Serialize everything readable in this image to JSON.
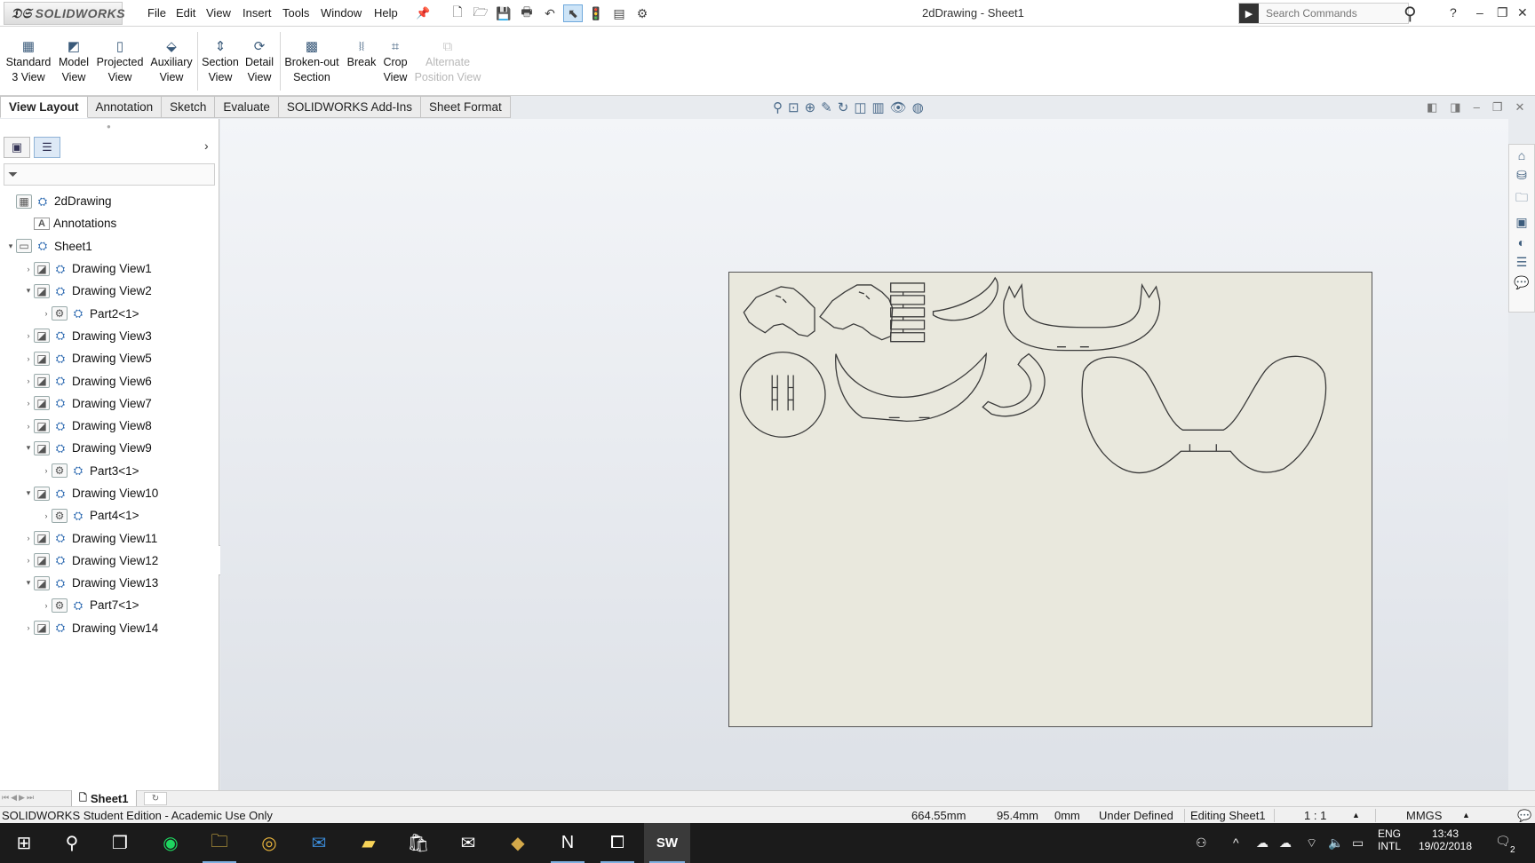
{
  "app": {
    "logo_text": "SOLIDWORKS",
    "document_title": "2dDrawing - Sheet1"
  },
  "menu": [
    "File",
    "Edit",
    "View",
    "Insert",
    "Tools",
    "Window",
    "Help"
  ],
  "search": {
    "placeholder": "Search Commands"
  },
  "commands": [
    {
      "line1": "Standard",
      "line2": "3 View",
      "icon": "standard-3-view-icon",
      "enabled": true
    },
    {
      "line1": "Model",
      "line2": "View",
      "icon": "model-view-icon",
      "enabled": true
    },
    {
      "line1": "Projected",
      "line2": "View",
      "icon": "projected-view-icon",
      "enabled": true
    },
    {
      "line1": "Auxiliary",
      "line2": "View",
      "icon": "auxiliary-view-icon",
      "enabled": true
    },
    {
      "line1": "Section",
      "line2": "View",
      "icon": "section-view-icon",
      "enabled": true
    },
    {
      "line1": "Detail",
      "line2": "View",
      "icon": "detail-view-icon",
      "enabled": true
    },
    {
      "line1": "Broken-out",
      "line2": "Section",
      "icon": "broken-out-section-icon",
      "enabled": true
    },
    {
      "line1": "Break",
      "line2": "",
      "icon": "break-icon",
      "enabled": true
    },
    {
      "line1": "Crop",
      "line2": "View",
      "icon": "crop-view-icon",
      "enabled": true
    },
    {
      "line1": "Alternate",
      "line2": "Position View",
      "icon": "alternate-position-view-icon",
      "enabled": false
    }
  ],
  "tabs": [
    "View Layout",
    "Annotation",
    "Sketch",
    "Evaluate",
    "SOLIDWORKS Add-Ins",
    "Sheet Format"
  ],
  "active_tab": "View Layout",
  "tree": [
    {
      "label": "2dDrawing",
      "level": 0,
      "toggle": "",
      "type": "root"
    },
    {
      "label": "Annotations",
      "level": 1,
      "toggle": "",
      "type": "annotations"
    },
    {
      "label": "Sheet1",
      "level": 0,
      "toggle": "expanded",
      "type": "sheet"
    },
    {
      "label": "Drawing View1",
      "level": 1,
      "toggle": "collapsed",
      "type": "view"
    },
    {
      "label": "Drawing View2",
      "level": 1,
      "toggle": "expanded",
      "type": "view"
    },
    {
      "label": "Part2<1>",
      "level": 2,
      "toggle": "collapsed",
      "type": "part"
    },
    {
      "label": "Drawing View3",
      "level": 1,
      "toggle": "collapsed",
      "type": "view"
    },
    {
      "label": "Drawing View5",
      "level": 1,
      "toggle": "collapsed",
      "type": "view"
    },
    {
      "label": "Drawing View6",
      "level": 1,
      "toggle": "collapsed",
      "type": "view"
    },
    {
      "label": "Drawing View7",
      "level": 1,
      "toggle": "collapsed",
      "type": "view"
    },
    {
      "label": "Drawing View8",
      "level": 1,
      "toggle": "collapsed",
      "type": "view"
    },
    {
      "label": "Drawing View9",
      "level": 1,
      "toggle": "expanded",
      "type": "view"
    },
    {
      "label": "Part3<1>",
      "level": 2,
      "toggle": "collapsed",
      "type": "part"
    },
    {
      "label": "Drawing View10",
      "level": 1,
      "toggle": "expanded",
      "type": "view"
    },
    {
      "label": "Part4<1>",
      "level": 2,
      "toggle": "collapsed",
      "type": "part"
    },
    {
      "label": "Drawing View11",
      "level": 1,
      "toggle": "collapsed",
      "type": "view"
    },
    {
      "label": "Drawing View12",
      "level": 1,
      "toggle": "collapsed",
      "type": "view"
    },
    {
      "label": "Drawing View13",
      "level": 1,
      "toggle": "expanded",
      "type": "view"
    },
    {
      "label": "Part7<1>",
      "level": 2,
      "toggle": "collapsed",
      "type": "part"
    },
    {
      "label": "Drawing View14",
      "level": 1,
      "toggle": "collapsed",
      "type": "view"
    }
  ],
  "sheet_tab": "Sheet1",
  "status": {
    "edition": "SOLIDWORKS Student Edition - Academic Use Only",
    "x": "664.55mm",
    "y": "95.4mm",
    "z": "0mm",
    "definition": "Under Defined",
    "editing": "Editing Sheet1",
    "scale": "1 : 1",
    "units": "MMGS"
  },
  "taskbar": {
    "language_line1": "ENG",
    "language_line2": "INTL",
    "time": "13:43",
    "date": "19/02/2018",
    "notification_count": "2",
    "solidworks_badge": "SW"
  },
  "colors": {
    "sheet": "#e9e8dd",
    "active_tab": "#ffffff",
    "taskbar": "#1b1b1b",
    "tree_icon": "#2a68b0"
  }
}
